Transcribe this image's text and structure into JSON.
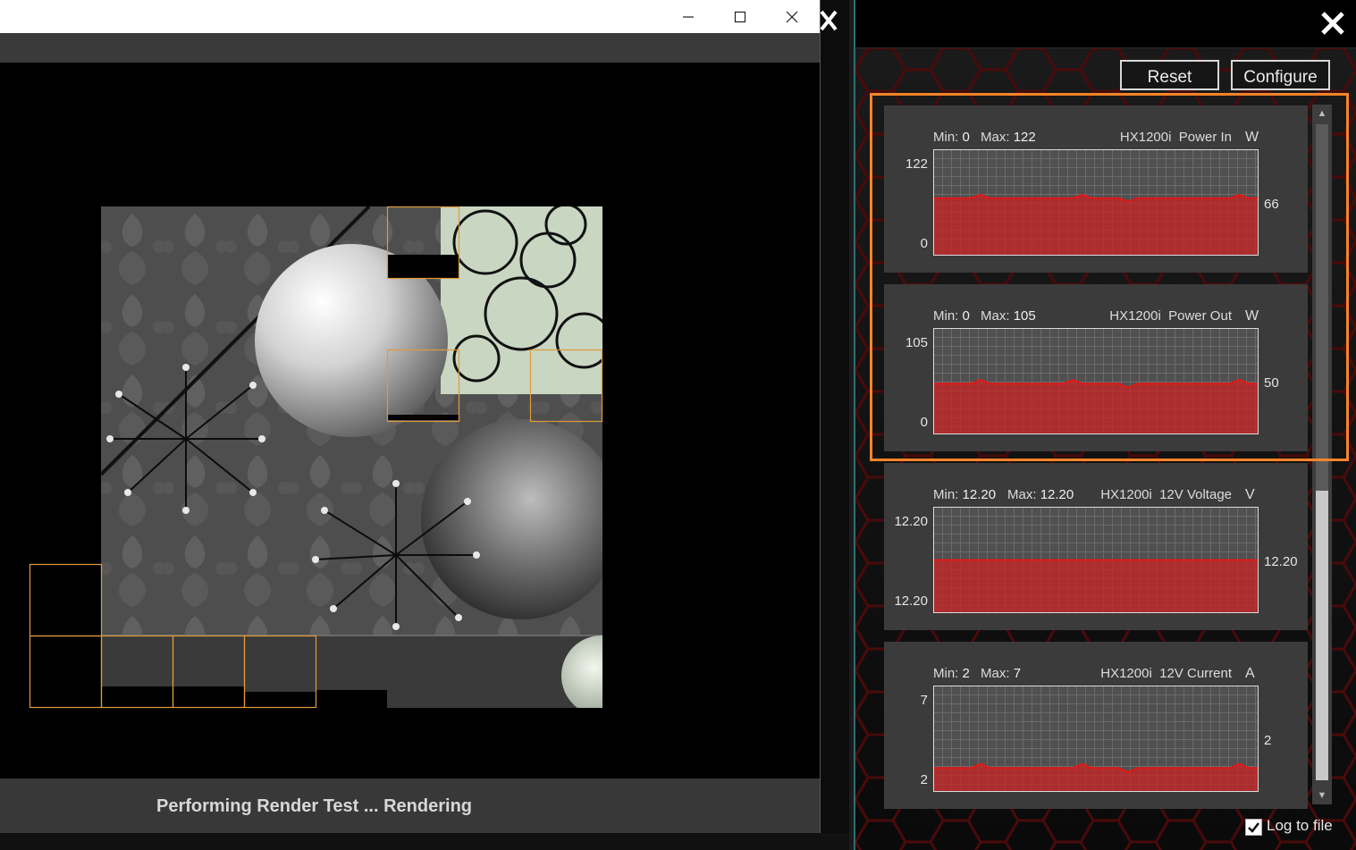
{
  "render_window": {
    "status": "Performing Render Test ... Rendering",
    "highlight_color": "#f0a040"
  },
  "panel": {
    "reset_label": "Reset",
    "configure_label": "Configure",
    "log_label": "Log to file",
    "log_checked": true,
    "accent_color": "#d02020",
    "highlight_color": "#f7842a",
    "sensors": [
      {
        "min_label": "Min:",
        "min": "0",
        "max_label": "Max:",
        "max": "122",
        "device": "HX1200i",
        "name": "Power In",
        "unit": "W",
        "y_top": "122",
        "y_bottom": "0",
        "current": "66",
        "chart_data": {
          "type": "area",
          "ylim": [
            0,
            122
          ],
          "values": [
            66,
            66,
            66,
            66,
            66,
            70,
            66,
            66,
            66,
            66,
            66,
            66,
            66,
            66,
            66,
            66,
            70,
            66,
            66,
            66,
            66,
            62,
            66,
            66,
            66,
            66,
            66,
            66,
            66,
            66,
            66,
            66,
            66,
            70,
            66,
            66
          ]
        }
      },
      {
        "min_label": "Min:",
        "min": "0",
        "max_label": "Max:",
        "max": "105",
        "device": "HX1200i",
        "name": "Power Out",
        "unit": "W",
        "y_top": "105",
        "y_bottom": "0",
        "current": "50",
        "chart_data": {
          "type": "area",
          "ylim": [
            0,
            105
          ],
          "values": [
            50,
            50,
            50,
            50,
            50,
            54,
            50,
            50,
            50,
            50,
            50,
            50,
            50,
            50,
            50,
            54,
            50,
            50,
            50,
            50,
            50,
            46,
            50,
            50,
            50,
            50,
            50,
            50,
            50,
            50,
            50,
            50,
            50,
            54,
            50,
            50
          ]
        }
      },
      {
        "min_label": "Min:",
        "min": "12.20",
        "max_label": "Max:",
        "max": "12.20",
        "device": "HX1200i",
        "name": "12V Voltage",
        "unit": "V",
        "y_top": "12.20",
        "y_bottom": "12.20",
        "current": "12.20",
        "chart_data": {
          "type": "area",
          "ylim": [
            0,
            1
          ],
          "values": [
            0.5,
            0.5,
            0.5,
            0.5,
            0.5,
            0.5,
            0.5,
            0.5,
            0.5,
            0.5,
            0.5,
            0.5,
            0.5,
            0.5,
            0.5,
            0.5,
            0.5,
            0.5,
            0.5,
            0.5,
            0.5,
            0.5,
            0.5,
            0.5,
            0.5,
            0.5,
            0.5,
            0.5,
            0.5,
            0.5,
            0.5,
            0.5,
            0.5,
            0.5,
            0.5,
            0.5
          ]
        }
      },
      {
        "min_label": "Min:",
        "min": "2",
        "max_label": "Max:",
        "max": "7",
        "device": "HX1200i",
        "name": "12V Current",
        "unit": "A",
        "y_top": "7",
        "y_bottom": "2",
        "current": "2",
        "chart_data": {
          "type": "area",
          "ylim": [
            2,
            7
          ],
          "values": [
            3.1,
            3.1,
            3.1,
            3.1,
            3.1,
            3.3,
            3.1,
            3.1,
            3.1,
            3.1,
            3.1,
            3.1,
            3.1,
            3.1,
            3.1,
            3.1,
            3.3,
            3.1,
            3.1,
            3.1,
            3.1,
            2.9,
            3.1,
            3.1,
            3.1,
            3.1,
            3.1,
            3.1,
            3.1,
            3.1,
            3.1,
            3.1,
            3.1,
            3.3,
            3.1,
            3.1
          ]
        }
      }
    ]
  }
}
